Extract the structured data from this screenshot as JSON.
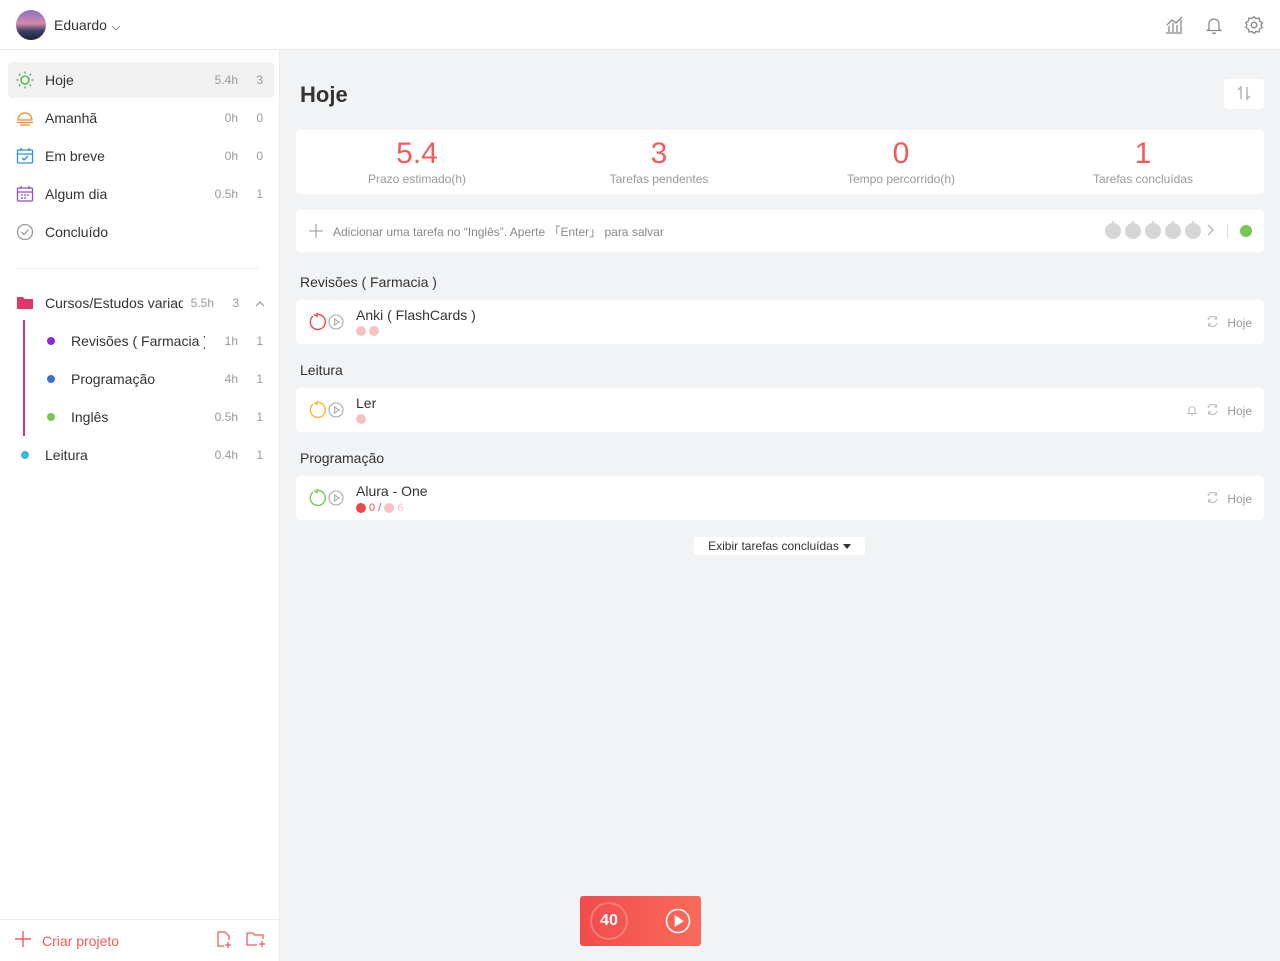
{
  "user": {
    "name": "Eduardo"
  },
  "sidebar": {
    "items": [
      {
        "label": "Hoje",
        "time": "5.4h",
        "count": "3",
        "icon": "sun-icon"
      },
      {
        "label": "Amanhã",
        "time": "0h",
        "count": "0",
        "icon": "sunset-icon"
      },
      {
        "label": "Em breve",
        "time": "0h",
        "count": "0",
        "icon": "calendar-check-icon"
      },
      {
        "label": "Algum dia",
        "time": "0.5h",
        "count": "1",
        "icon": "calendar-icon"
      },
      {
        "label": "Concluído",
        "time": "",
        "count": "",
        "icon": "check-circle-icon"
      }
    ],
    "folder": {
      "label": "Cursos/Estudos variados",
      "time": "5.5h",
      "count": "3",
      "color": "#e0366c"
    },
    "projects": [
      {
        "label": "Revisões ( Farmacia )",
        "time": "1h",
        "count": "1",
        "color": "#8a2be2"
      },
      {
        "label": "Programação",
        "time": "4h",
        "count": "1",
        "color": "#3a6fe0"
      },
      {
        "label": "Inglês",
        "time": "0.5h",
        "count": "1",
        "color": "#7ac74f"
      },
      {
        "label": "Leitura",
        "time": "0.4h",
        "count": "1",
        "color": "#3bb4e8"
      }
    ],
    "create_label": "Criar projeto"
  },
  "main": {
    "title": "Hoje",
    "stats": [
      {
        "value": "5.4",
        "label": "Prazo estimado(h)"
      },
      {
        "value": "3",
        "label": "Tarefas pendentes"
      },
      {
        "value": "0",
        "label": "Tempo percorrido(h)"
      },
      {
        "value": "1",
        "label": "Tarefas concluídas"
      }
    ],
    "add_placeholder": "Adicionar uma tarefa no “Inglês”. Aperte 「Enter」 para salvar",
    "groups": [
      {
        "title": "Revisões ( Farmacia )",
        "task": {
          "name": "Anki ( FlashCards )",
          "due": "Hoje",
          "circle_color": "#f04848"
        }
      },
      {
        "title": "Leitura",
        "task": {
          "name": "Ler",
          "due": "Hoje",
          "circle_color": "#f5b82e"
        }
      },
      {
        "title": "Programação",
        "task": {
          "name": "Alura - One",
          "due": "Hoje",
          "done": "0",
          "total": "6",
          "circle_color": "#7ac74f"
        }
      }
    ],
    "show_done": "Exibir tarefas concluídas"
  },
  "pomodoro": {
    "minutes": "40"
  },
  "colors": {
    "accent": "#f15b5b"
  }
}
